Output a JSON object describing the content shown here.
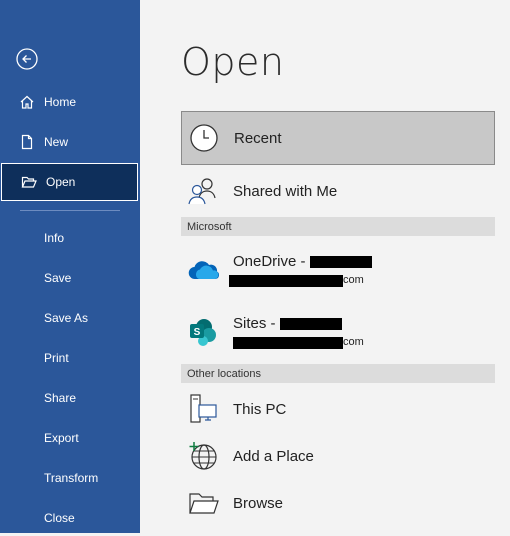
{
  "nav": {
    "back_label": "Back",
    "items": [
      {
        "label": "Home",
        "icon": "home-icon"
      },
      {
        "label": "New",
        "icon": "new-document-icon"
      },
      {
        "label": "Open",
        "icon": "folder-open-icon",
        "active": true
      },
      {
        "label": "Info"
      },
      {
        "label": "Save"
      },
      {
        "label": "Save As"
      },
      {
        "label": "Print"
      },
      {
        "label": "Share"
      },
      {
        "label": "Export"
      },
      {
        "label": "Transform"
      },
      {
        "label": "Close"
      }
    ]
  },
  "main": {
    "title": "Open",
    "locations": [
      {
        "label": "Recent",
        "icon": "clock-icon",
        "selected": true
      },
      {
        "label": "Shared with Me",
        "icon": "people-icon"
      }
    ],
    "sections": [
      {
        "label": "Microsoft"
      },
      {
        "label": "Other locations"
      }
    ],
    "cloud": [
      {
        "label": "OneDrive - ",
        "sub_suffix": "com",
        "icon": "onedrive-icon"
      },
      {
        "label": "Sites - ",
        "sub_suffix": "com",
        "icon": "sharepoint-icon"
      }
    ],
    "other": [
      {
        "label": "This PC",
        "icon": "computer-icon"
      },
      {
        "label": "Add a Place",
        "icon": "globe-add-icon"
      },
      {
        "label": "Browse",
        "icon": "folder-icon"
      }
    ]
  },
  "colors": {
    "nav_bg": "#2b579a",
    "active_bg": "#0e2f5b",
    "selected_bg": "#c8c8c8"
  }
}
